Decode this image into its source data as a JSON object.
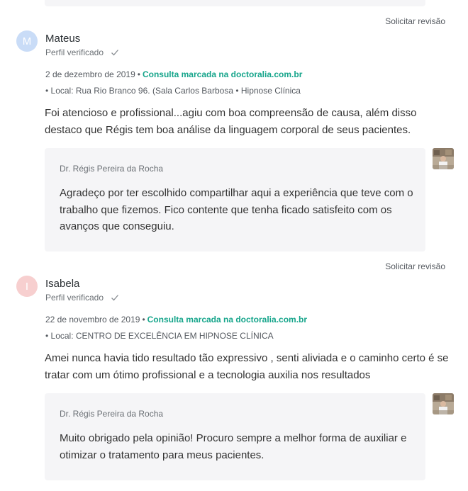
{
  "reviews": [
    {
      "report_label": "Solicitar revisão",
      "avatar_letter": "M",
      "name": "Mateus",
      "verified_label": "Perfil verificado",
      "date": "2 de dezembro de 2019",
      "booked_label": "Consulta marcada na doctoralia.com.br",
      "location": "• Local: Rua Rio Branco 96. (Sala Carlos Barbosa • Hipnose Clínica",
      "comment": "Foi atencioso e profissional...agiu com boa compreensão de causa, além disso destaco que Régis tem boa análise da linguagem corporal de seus pacientes.",
      "reply": {
        "author": "Dr. Régis Pereira da Rocha",
        "text": "Agradeço por ter escolhido compartilhar aqui a experiência que teve com o trabalho que fizemos. Fico contente que tenha ficado satisfeito com os avanços que conseguiu."
      }
    },
    {
      "report_label": "Solicitar revisão",
      "avatar_letter": "I",
      "name": "Isabela",
      "verified_label": "Perfil verificado",
      "date": "22 de novembro de 2019",
      "booked_label": "Consulta marcada na doctoralia.com.br",
      "location": "• Local: CENTRO DE EXCELÊNCIA EM HIPNOSE CLÍNICA",
      "comment": "Amei nunca havia tido resultado tão expressivo , senti aliviada e o caminho certo é se tratar com um ótimo profissional e a tecnologia auxilia nos resultados",
      "reply": {
        "author": "Dr. Régis Pereira da Rocha",
        "text": "Muito obrigado pela opinião! Procuro sempre a melhor forma de auxiliar e otimizar o tratamento para meus pacientes."
      }
    }
  ],
  "colors": {
    "accent_green": "#16a58b",
    "reply_bg": "#f5f5f7",
    "avatar_blue": "#c9dcf7",
    "avatar_pink": "#f7cfcf"
  },
  "icons": {
    "verified": "check-icon",
    "doctor_photo": "doctor-avatar-icon"
  }
}
